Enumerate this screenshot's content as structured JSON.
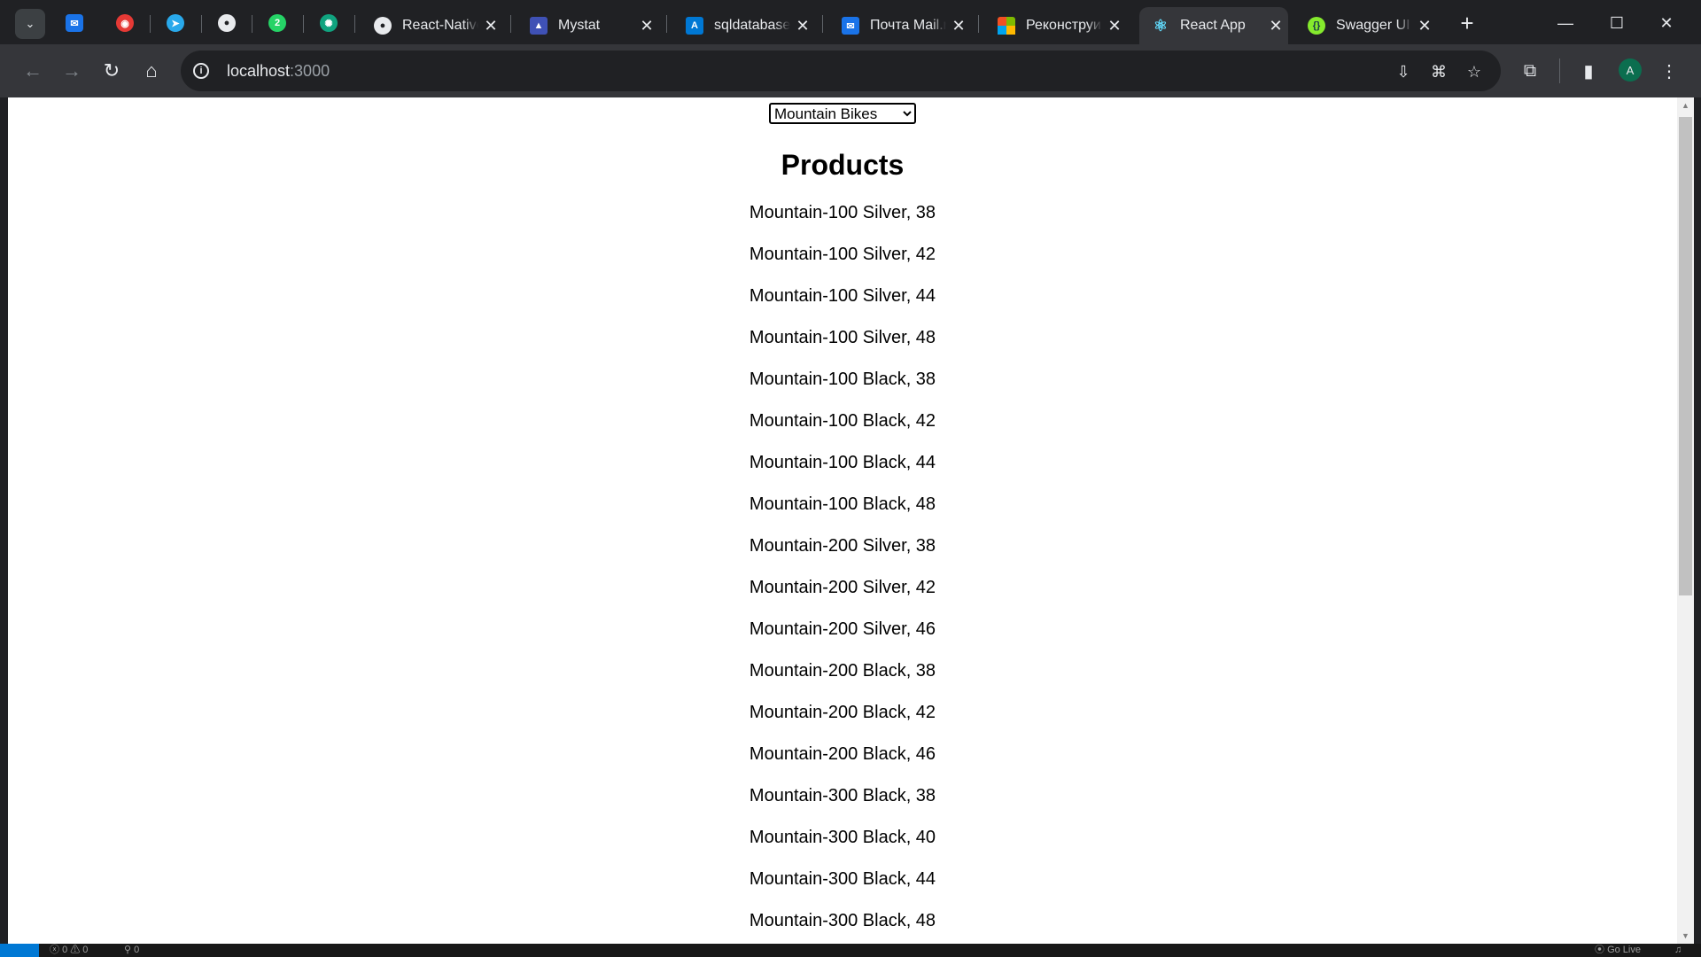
{
  "browser": {
    "tabs": [
      {
        "title": "React-Native",
        "active": false
      },
      {
        "title": "Mystat",
        "active": false
      },
      {
        "title": "sqldatabase (",
        "active": false
      },
      {
        "title": "Почта Mail.ru",
        "active": false
      },
      {
        "title": "Реконструир",
        "active": false
      },
      {
        "title": "React App",
        "active": true
      },
      {
        "title": "Swagger UI",
        "active": false
      }
    ],
    "pinned_badge": "2",
    "url_host": "localhost",
    "url_port": ":3000",
    "avatar_letter": "A"
  },
  "page": {
    "select_value": "Mountain Bikes",
    "heading": "Products",
    "products": [
      "Mountain-100 Silver, 38",
      "Mountain-100 Silver, 42",
      "Mountain-100 Silver, 44",
      "Mountain-100 Silver, 48",
      "Mountain-100 Black, 38",
      "Mountain-100 Black, 42",
      "Mountain-100 Black, 44",
      "Mountain-100 Black, 48",
      "Mountain-200 Silver, 38",
      "Mountain-200 Silver, 42",
      "Mountain-200 Silver, 46",
      "Mountain-200 Black, 38",
      "Mountain-200 Black, 42",
      "Mountain-200 Black, 46",
      "Mountain-300 Black, 38",
      "Mountain-300 Black, 40",
      "Mountain-300 Black, 44",
      "Mountain-300 Black, 48"
    ]
  },
  "statusbar": {
    "problems": "0 ⚠ 0",
    "ports": "0",
    "go_live": "Go Live"
  },
  "colors": {
    "chrome_dark": "#202124",
    "chrome_toolbar": "#35363a",
    "page_bg": "#ffffff",
    "vscode_blue": "#0078d4"
  }
}
